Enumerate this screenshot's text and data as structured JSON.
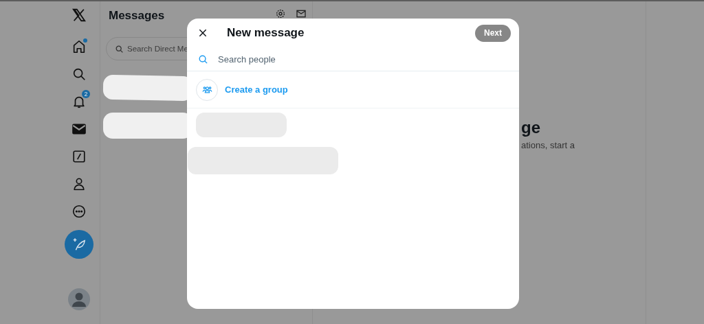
{
  "nav": [
    {
      "kind": "home",
      "selected": false,
      "new_dot": true
    },
    {
      "kind": "search",
      "selected": false
    },
    {
      "kind": "notifications",
      "selected": false,
      "badge": "2"
    },
    {
      "kind": "messages",
      "selected": true
    },
    {
      "kind": "grok",
      "selected": false
    },
    {
      "kind": "profile",
      "selected": false
    },
    {
      "kind": "more",
      "selected": false
    }
  ],
  "messages_panel": {
    "title": "Messages",
    "search": {
      "placeholder": "Search Direct Me"
    }
  },
  "empty_state": {
    "title": "ge",
    "text": "ations, start a"
  },
  "dialog": {
    "title": "New message",
    "next_button": {
      "label": "Next",
      "disabled": true
    },
    "search": {
      "placeholder": "Search people"
    },
    "create_group": "Create a group"
  }
}
